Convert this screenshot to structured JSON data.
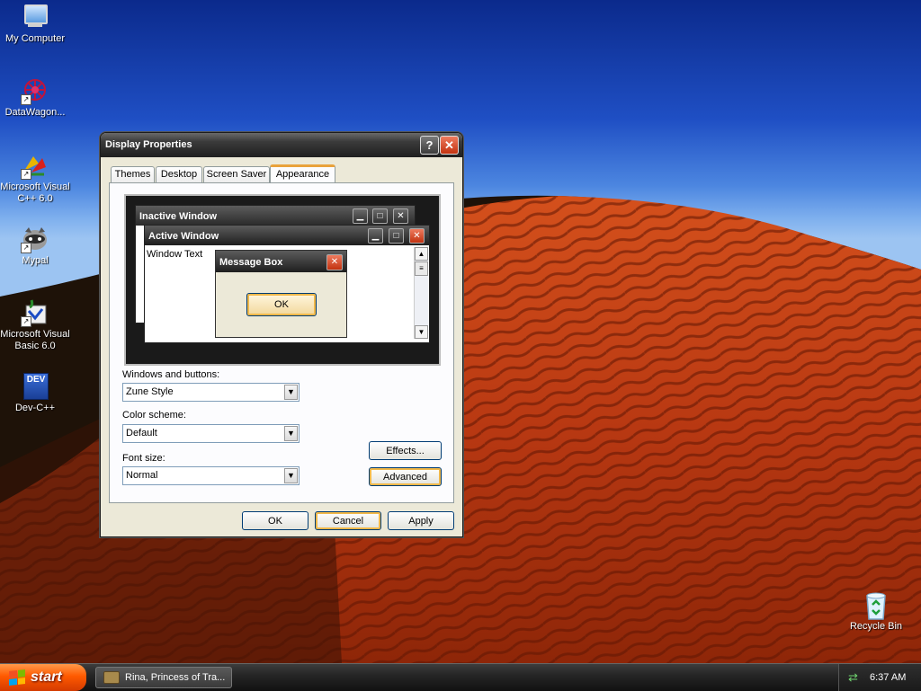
{
  "desktop": {
    "icons": [
      {
        "label": "My Computer"
      },
      {
        "label": "DataWagon..."
      },
      {
        "label": "Microsoft Visual C++ 6.0"
      },
      {
        "label": "Mypal"
      },
      {
        "label": "Microsoft Visual Basic 6.0"
      },
      {
        "label": "Dev-C++",
        "badge": "DEV"
      },
      {
        "label": "Recycle Bin"
      }
    ]
  },
  "dialog": {
    "title": "Display Properties",
    "help_glyph": "?",
    "close_glyph": "✕",
    "tabs": [
      {
        "label": "Themes"
      },
      {
        "label": "Desktop"
      },
      {
        "label": "Screen Saver"
      },
      {
        "label": "Appearance",
        "active": true
      }
    ],
    "preview": {
      "inactive_title": "Inactive Window",
      "active_title": "Active Window",
      "window_text": "Window Text",
      "message_box_title": "Message Box",
      "ok_label": "OK"
    },
    "windows_buttons": {
      "label": "Windows and buttons:",
      "value": "Zune Style"
    },
    "color_scheme": {
      "label": "Color scheme:",
      "value": "Default"
    },
    "font_size": {
      "label": "Font size:",
      "value": "Normal"
    },
    "effects_label": "Effects...",
    "advanced_label": "Advanced",
    "ok_label": "OK",
    "cancel_label": "Cancel",
    "apply_label": "Apply"
  },
  "taskbar": {
    "start_label": "start",
    "task_label": "Rina, Princess of Tra...",
    "clock": "6:37 AM"
  },
  "colors": {
    "start_orange": "#ff5a00",
    "focus_ring": "#f0b84a",
    "title_dark": "#1f1f1f",
    "close_red": "#c23210"
  }
}
